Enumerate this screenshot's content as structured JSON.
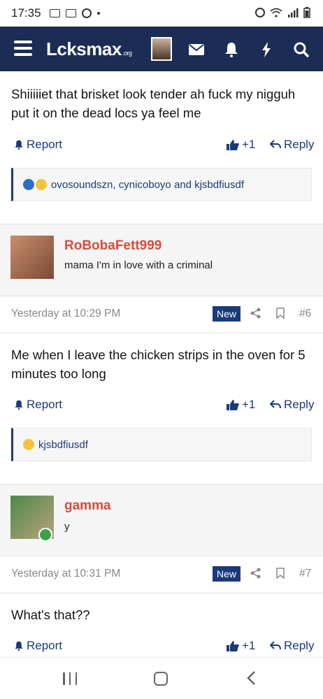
{
  "status_bar": {
    "time": "17:35"
  },
  "header": {
    "logo_text": "Lcksmax",
    "logo_suffix": ".org"
  },
  "posts": [
    {
      "text": "Shiiiiiet that brisket look tender ah fuck my nigguh put it on the dead locs ya feel me",
      "report_label": "Report",
      "like_count": "+1",
      "reply_label": "Reply",
      "reactions_text": "ovosoundszn, cynicoboyo and kjsbdfiusdf"
    },
    {
      "author": "RoBobaFett999",
      "author_title": "mama I'm in love with a criminal",
      "date": "Yesterday at 10:29 PM",
      "new_badge": "New",
      "post_number": "#6",
      "text": "Me when I leave the chicken strips in the oven for 5 minutes too long",
      "report_label": "Report",
      "like_count": "+1",
      "reply_label": "Reply",
      "reactions_text": "kjsbdfiusdf"
    },
    {
      "author": "gamma",
      "author_title": "y",
      "date": "Yesterday at 10:31 PM",
      "new_badge": "New",
      "post_number": "#7",
      "text": "What's that??",
      "report_label": "Report",
      "like_count": "+1",
      "reply_label": "Reply"
    }
  ],
  "colors": {
    "header_bg": "#1b2d54",
    "accent": "#1b3a7a",
    "username": "#d94b3b"
  }
}
